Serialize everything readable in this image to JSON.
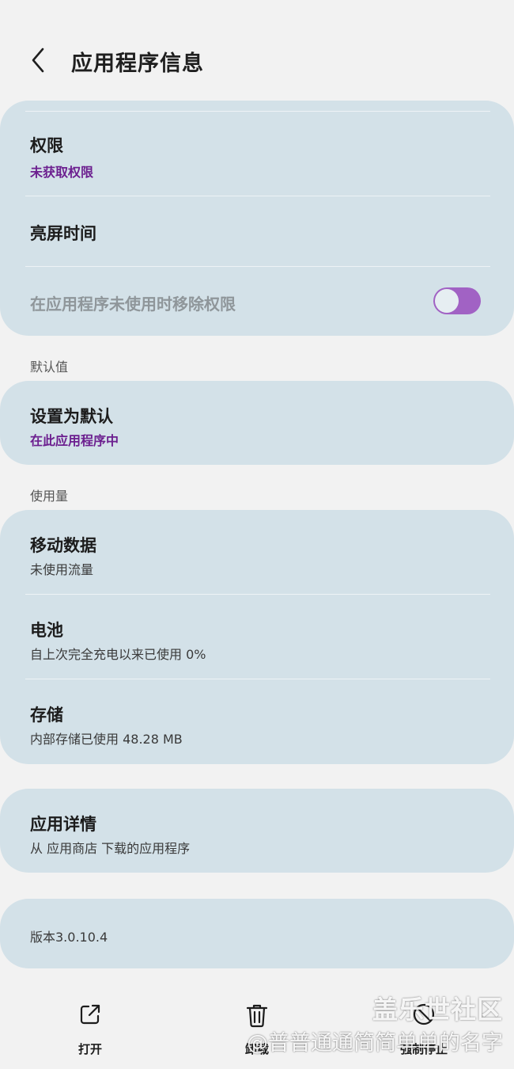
{
  "header": {
    "title": "应用程序信息"
  },
  "permissions_card": {
    "permissions_title": "权限",
    "permissions_sub": "未获取权限",
    "screen_time_title": "亮屏时间",
    "remove_permissions_label": "在应用程序未使用时移除权限",
    "remove_permissions_on": true
  },
  "defaults": {
    "section_label": "默认值",
    "set_default_title": "设置为默认",
    "set_default_sub": "在此应用程序中"
  },
  "usage": {
    "section_label": "使用量",
    "mobile_data_title": "移动数据",
    "mobile_data_sub": "未使用流量",
    "battery_title": "电池",
    "battery_sub": "自上次完全充电以来已使用 0%",
    "storage_title": "存储",
    "storage_sub": "内部存储已使用 48.28 MB"
  },
  "app_details": {
    "title": "应用详情",
    "sub": "从 应用商店 下载的应用程序"
  },
  "version": {
    "label": "版本3.0.10.4"
  },
  "bottom_bar": {
    "open_label": "打开",
    "uninstall_label": "卸载",
    "force_stop_label": "强制停止"
  },
  "watermark": {
    "brand": "盖乐世社区",
    "user": "@普普通通简简单单的名字"
  },
  "colors": {
    "background": "#f2f2f2",
    "card": "#d3e1e8",
    "accent_purple": "#6c1f8f",
    "toggle_on": "#a162c4"
  }
}
